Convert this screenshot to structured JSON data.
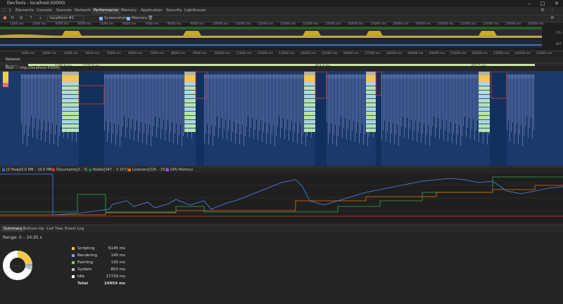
{
  "window": {
    "title": "DevTools - localhost:50000/"
  },
  "tabs": [
    {
      "label": "Elements"
    },
    {
      "label": "Console"
    },
    {
      "label": "Sources"
    },
    {
      "label": "Network"
    },
    {
      "label": "Performance"
    },
    {
      "label": "Memory"
    },
    {
      "label": "Application"
    },
    {
      "label": "Security"
    },
    {
      "label": "Lighthouse"
    }
  ],
  "toolbar": {
    "profile_select": "localhost #1",
    "screenshots_label": "Screenshots",
    "memory_label": "Memory"
  },
  "ruler_top": [
    "1000 ms",
    "2000 ms",
    "3000 ms",
    "4000 ms",
    "5000 ms",
    "6000 ms",
    "7000 ms",
    "8000 ms",
    "9000 ms",
    "10000 ms",
    "11000 ms",
    "12000 ms",
    "13000 ms",
    "14000 ms",
    "15000 ms",
    "16000 ms",
    "17000 ms",
    "18000 ms",
    "19000 ms",
    "20000 ms",
    "21000 ms",
    "22000 ms",
    "23000 ms",
    "24000 ms"
  ],
  "ruler_main": [
    "1000 ms",
    "2000 ms",
    "3000 ms",
    "4000 ms",
    "5000 ms",
    "6000 ms",
    "7000 ms",
    "8000 ms",
    "9000 ms",
    "10000 ms",
    "11000 ms",
    "12000 ms",
    "13000 ms",
    "14000 ms",
    "15000 ms",
    "16000 ms",
    "17000 ms",
    "18000 ms",
    "19000 ms",
    "20000 ms",
    "21000 ms",
    "22000 ms",
    "23000 ms",
    "24000 ms",
    "25000 ms"
  ],
  "overview_labels": {
    "cpu": "CPU",
    "net": "NET"
  },
  "tracks": {
    "network": "Network",
    "frames": "Frames",
    "frames_values": [
      "1297.6 ms",
      "1275.6 ms",
      "822.4 ms",
      "821.5 ms"
    ],
    "main": "Main — http://localhost:50000/"
  },
  "memory_legend": [
    {
      "label": "JS Heap[6.6 MB – 10.6 MB]",
      "color": "#1a73e8"
    },
    {
      "label": "Documents[2 – 5]",
      "color": "#d93025"
    },
    {
      "label": "Nodes[347 – 3 157]",
      "color": "#188038"
    },
    {
      "label": "Listeners[326 – 152]",
      "color": "#e8710a"
    },
    {
      "label": "GPU Memory",
      "color": "#a142f4"
    }
  ],
  "bottom_tabs": [
    {
      "label": "Summary"
    },
    {
      "label": "Bottom-Up"
    },
    {
      "label": "Call Tree"
    },
    {
      "label": "Event Log"
    }
  ],
  "summary": {
    "range": "Range: 0 – 24.95 s",
    "total_center": "24954 ms",
    "rows": [
      {
        "ms": "6145 ms",
        "name": "Scripting",
        "color": "#f2c94c"
      },
      {
        "ms": "140 ms",
        "name": "Rendering",
        "color": "#9b8ef0"
      },
      {
        "ms": "130 ms",
        "name": "Painting",
        "color": "#6dcb73"
      },
      {
        "ms": "803 ms",
        "name": "System",
        "color": "#bdbdbd"
      },
      {
        "ms": "17739 ms",
        "name": "Idle",
        "color": "#ffffff"
      },
      {
        "ms": "24954 ms",
        "name": "Total",
        "color": ""
      }
    ]
  }
}
